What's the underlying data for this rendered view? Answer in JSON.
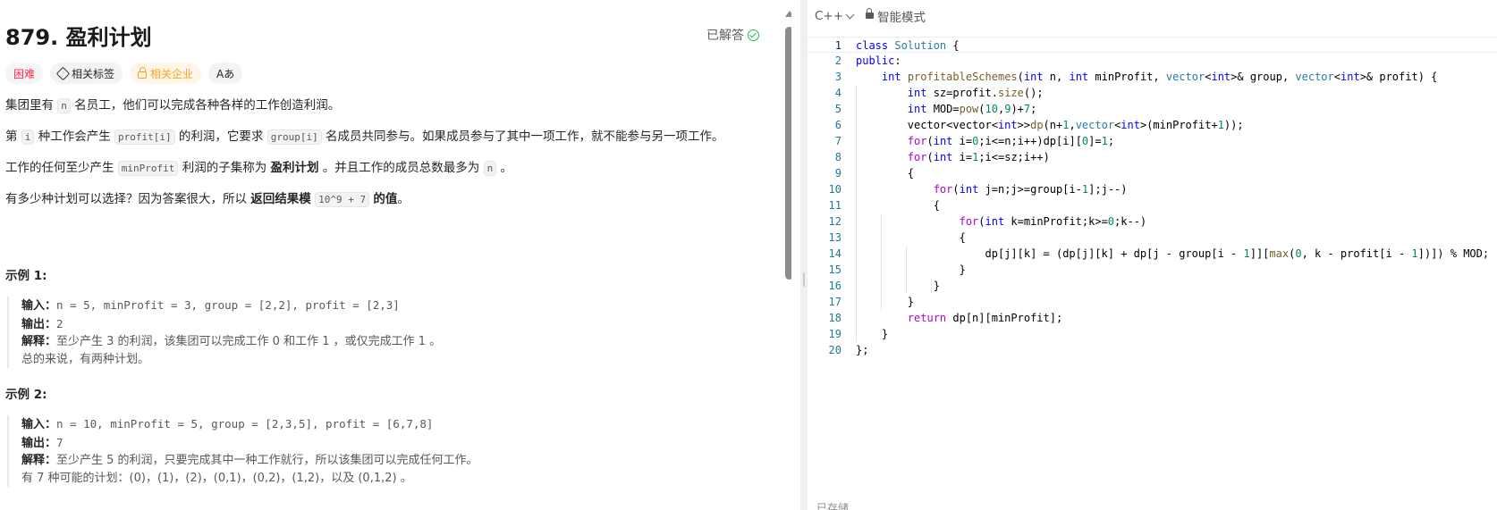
{
  "problem": {
    "title": "879. 盈利计划",
    "solved_label": "已解答",
    "tags": {
      "difficulty": "困难",
      "related_tags": "相关标签",
      "related_companies": "相关企业",
      "font_toggle": "Aあ"
    },
    "para1": {
      "a": "集团里有",
      "code": "n",
      "b": "名员工，他们可以完成各种各样的工作创造利润。"
    },
    "para2": {
      "a": "第",
      "code1": "i",
      "b": "种工作会产生",
      "code2": "profit[i]",
      "c": "的利润，它要求",
      "code3": "group[i]",
      "d": "名成员共同参与。如果成员参与了其中一项工作，就不能参与另一项工作。"
    },
    "para3": {
      "a": "工作的任何至少产生",
      "code1": "minProfit",
      "b": "利润的子集称为",
      "bold": "盈利计划",
      "c": "。并且工作的成员总数最多为",
      "code2": "n",
      "d": "。"
    },
    "para4": {
      "a": "有多少种计划可以选择？因为答案很大，所以",
      "bold1": "返回结果模",
      "code": "10^9 + 7",
      "bold2": "的值",
      "d": "。"
    },
    "examples": [
      {
        "title": "示例 1:",
        "input_label": "输入：",
        "input": "n = 5, minProfit = 3, group = [2,2], profit = [2,3]",
        "output_label": "输出：",
        "output": "2",
        "explain_label": "解释：",
        "explain": "至少产生 3 的利润，该集团可以完成工作 0 和工作 1 ，或仅完成工作 1 。",
        "extra": "总的来说，有两种计划。"
      },
      {
        "title": "示例 2:",
        "input_label": "输入：",
        "input": "n = 10, minProfit = 5, group = [2,3,5], profit = [6,7,8]",
        "output_label": "输出：",
        "output": "7",
        "explain_label": "解释：",
        "explain": "至少产生 5 的利润，只要完成其中一种工作就行，所以该集团可以完成任何工作。",
        "extra": "有 7 种可能的计划：(0)，(1)，(2)，(0,1)，(0,2)，(1,2)，以及 (0,1,2) 。"
      }
    ]
  },
  "editor": {
    "language": "C++",
    "mode": "智能模式",
    "line_numbers": [
      "1",
      "2",
      "3",
      "4",
      "5",
      "6",
      "7",
      "8",
      "9",
      "10",
      "11",
      "12",
      "13",
      "14",
      "15",
      "16",
      "17",
      "18",
      "19",
      "20"
    ],
    "status": "已存储"
  }
}
